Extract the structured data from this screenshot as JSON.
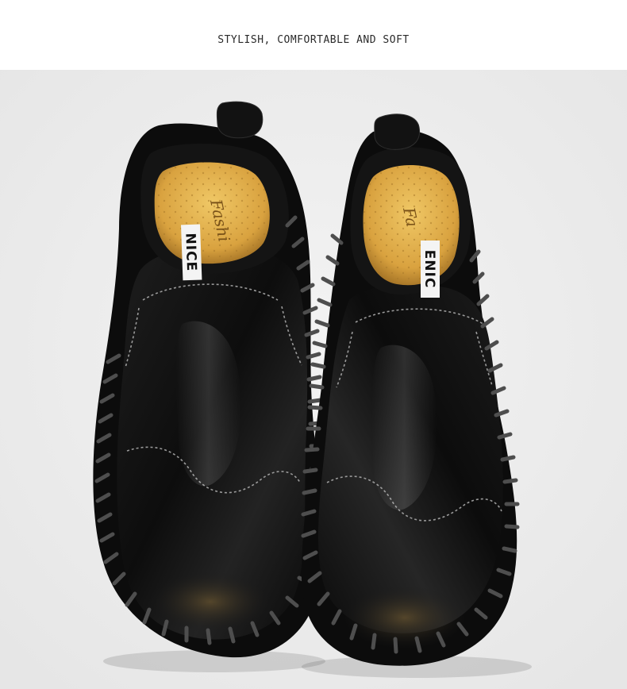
{
  "header": {
    "headline": "STYLISH, COMFORTABLE AND SOFT"
  },
  "product_photo": {
    "background_color": "#eeeeee",
    "left_shoe": {
      "tab_label": "NICE",
      "insole_script": "Fashi"
    },
    "right_shoe": {
      "tab_label": "ENIC",
      "insole_script": "Fa"
    },
    "colors": {
      "leather": "#0f0f0f",
      "insole": "#e3b451",
      "stitching": "#6b6b6b",
      "lace": "#4e4e4e"
    }
  }
}
